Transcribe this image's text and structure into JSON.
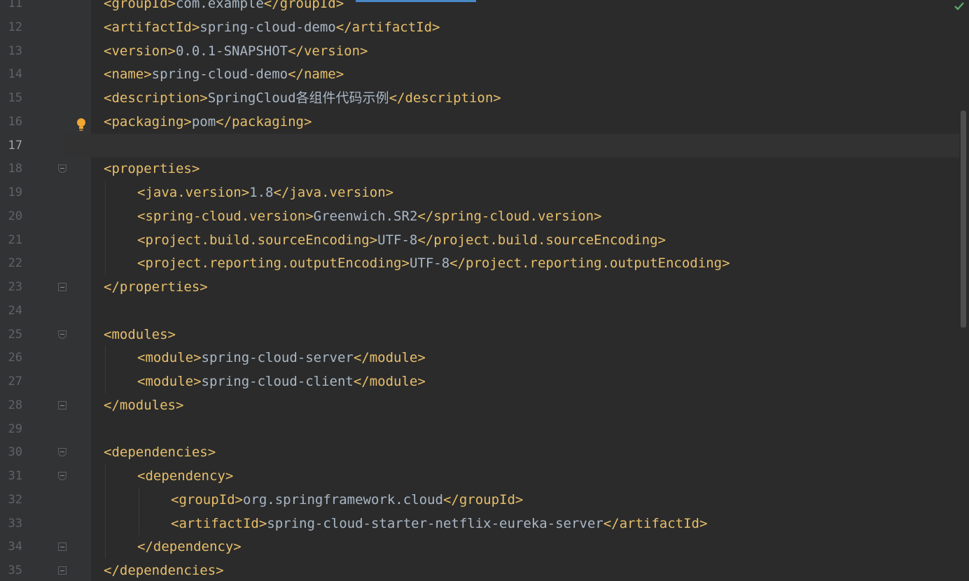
{
  "editor": {
    "inspection_status_icon": "checkmark-icon",
    "intention_icon": "lightbulb-icon",
    "current_line": 17
  },
  "lines": [
    {
      "no": "11",
      "depth": 0,
      "segs": [
        {
          "t": "tag",
          "s": "<groupId>"
        },
        {
          "t": "text",
          "s": "com.example"
        },
        {
          "t": "tag",
          "s": "</groupId>"
        }
      ]
    },
    {
      "no": "12",
      "depth": 0,
      "segs": [
        {
          "t": "tag",
          "s": "<artifactId>"
        },
        {
          "t": "text",
          "s": "spring-cloud-demo"
        },
        {
          "t": "tag",
          "s": "</artifactId>"
        }
      ]
    },
    {
      "no": "13",
      "depth": 0,
      "segs": [
        {
          "t": "tag",
          "s": "<version>"
        },
        {
          "t": "text",
          "s": "0.0.1-SNAPSHOT"
        },
        {
          "t": "tag",
          "s": "</version>"
        }
      ]
    },
    {
      "no": "14",
      "depth": 0,
      "segs": [
        {
          "t": "tag",
          "s": "<name>"
        },
        {
          "t": "text",
          "s": "spring-cloud-demo"
        },
        {
          "t": "tag",
          "s": "</name>"
        }
      ]
    },
    {
      "no": "15",
      "depth": 0,
      "segs": [
        {
          "t": "tag",
          "s": "<description>"
        },
        {
          "t": "text",
          "s": "SpringCloud各组件代码示例"
        },
        {
          "t": "tag",
          "s": "</description>"
        }
      ]
    },
    {
      "no": "16",
      "depth": 0,
      "segs": [
        {
          "t": "tag",
          "s": "<packaging>"
        },
        {
          "t": "text",
          "s": "pom"
        },
        {
          "t": "tag",
          "s": "</packaging>"
        }
      ]
    },
    {
      "no": "17",
      "depth": 0,
      "segs": []
    },
    {
      "no": "18",
      "depth": 0,
      "fold": "open",
      "segs": [
        {
          "t": "tag",
          "s": "<properties>"
        }
      ]
    },
    {
      "no": "19",
      "depth": 1,
      "segs": [
        {
          "t": "tag",
          "s": "<java.version>"
        },
        {
          "t": "text",
          "s": "1.8"
        },
        {
          "t": "tag",
          "s": "</java.version>"
        }
      ]
    },
    {
      "no": "20",
      "depth": 1,
      "segs": [
        {
          "t": "tag",
          "s": "<spring-cloud.version>"
        },
        {
          "t": "text",
          "s": "Greenwich.SR2"
        },
        {
          "t": "tag",
          "s": "</spring-cloud.version>"
        }
      ]
    },
    {
      "no": "21",
      "depth": 1,
      "segs": [
        {
          "t": "tag",
          "s": "<project.build.sourceEncoding>"
        },
        {
          "t": "text",
          "s": "UTF-8"
        },
        {
          "t": "tag",
          "s": "</project.build.sourceEncoding>"
        }
      ]
    },
    {
      "no": "22",
      "depth": 1,
      "segs": [
        {
          "t": "tag",
          "s": "<project.reporting.outputEncoding>"
        },
        {
          "t": "text",
          "s": "UTF-8"
        },
        {
          "t": "tag",
          "s": "</project.reporting.outputEncoding>"
        }
      ]
    },
    {
      "no": "23",
      "depth": 0,
      "fold": "close",
      "segs": [
        {
          "t": "tag",
          "s": "</properties>"
        }
      ]
    },
    {
      "no": "24",
      "depth": 0,
      "segs": []
    },
    {
      "no": "25",
      "depth": 0,
      "fold": "open",
      "segs": [
        {
          "t": "tag",
          "s": "<modules>"
        }
      ]
    },
    {
      "no": "26",
      "depth": 1,
      "segs": [
        {
          "t": "tag",
          "s": "<module>"
        },
        {
          "t": "text",
          "s": "spring-cloud-server"
        },
        {
          "t": "tag",
          "s": "</module>"
        }
      ]
    },
    {
      "no": "27",
      "depth": 1,
      "segs": [
        {
          "t": "tag",
          "s": "<module>"
        },
        {
          "t": "text",
          "s": "spring-cloud-client"
        },
        {
          "t": "tag",
          "s": "</module>"
        }
      ]
    },
    {
      "no": "28",
      "depth": 0,
      "fold": "close",
      "segs": [
        {
          "t": "tag",
          "s": "</modules>"
        }
      ]
    },
    {
      "no": "29",
      "depth": 0,
      "segs": []
    },
    {
      "no": "30",
      "depth": 0,
      "fold": "open",
      "segs": [
        {
          "t": "tag",
          "s": "<dependencies>"
        }
      ]
    },
    {
      "no": "31",
      "depth": 1,
      "fold": "open",
      "segs": [
        {
          "t": "tag",
          "s": "<dependency>"
        }
      ]
    },
    {
      "no": "32",
      "depth": 2,
      "segs": [
        {
          "t": "tag",
          "s": "<groupId>"
        },
        {
          "t": "text",
          "s": "org.springframework.cloud"
        },
        {
          "t": "tag",
          "s": "</groupId>"
        }
      ]
    },
    {
      "no": "33",
      "depth": 2,
      "segs": [
        {
          "t": "tag",
          "s": "<artifactId>"
        },
        {
          "t": "text",
          "s": "spring-cloud-starter-netflix-eureka-server"
        },
        {
          "t": "tag",
          "s": "</artifactId>"
        }
      ]
    },
    {
      "no": "34",
      "depth": 1,
      "fold": "close",
      "segs": [
        {
          "t": "tag",
          "s": "</dependency>"
        }
      ]
    },
    {
      "no": "35",
      "depth": 0,
      "fold": "close",
      "segs": [
        {
          "t": "tag",
          "s": "</dependencies>"
        }
      ]
    }
  ]
}
